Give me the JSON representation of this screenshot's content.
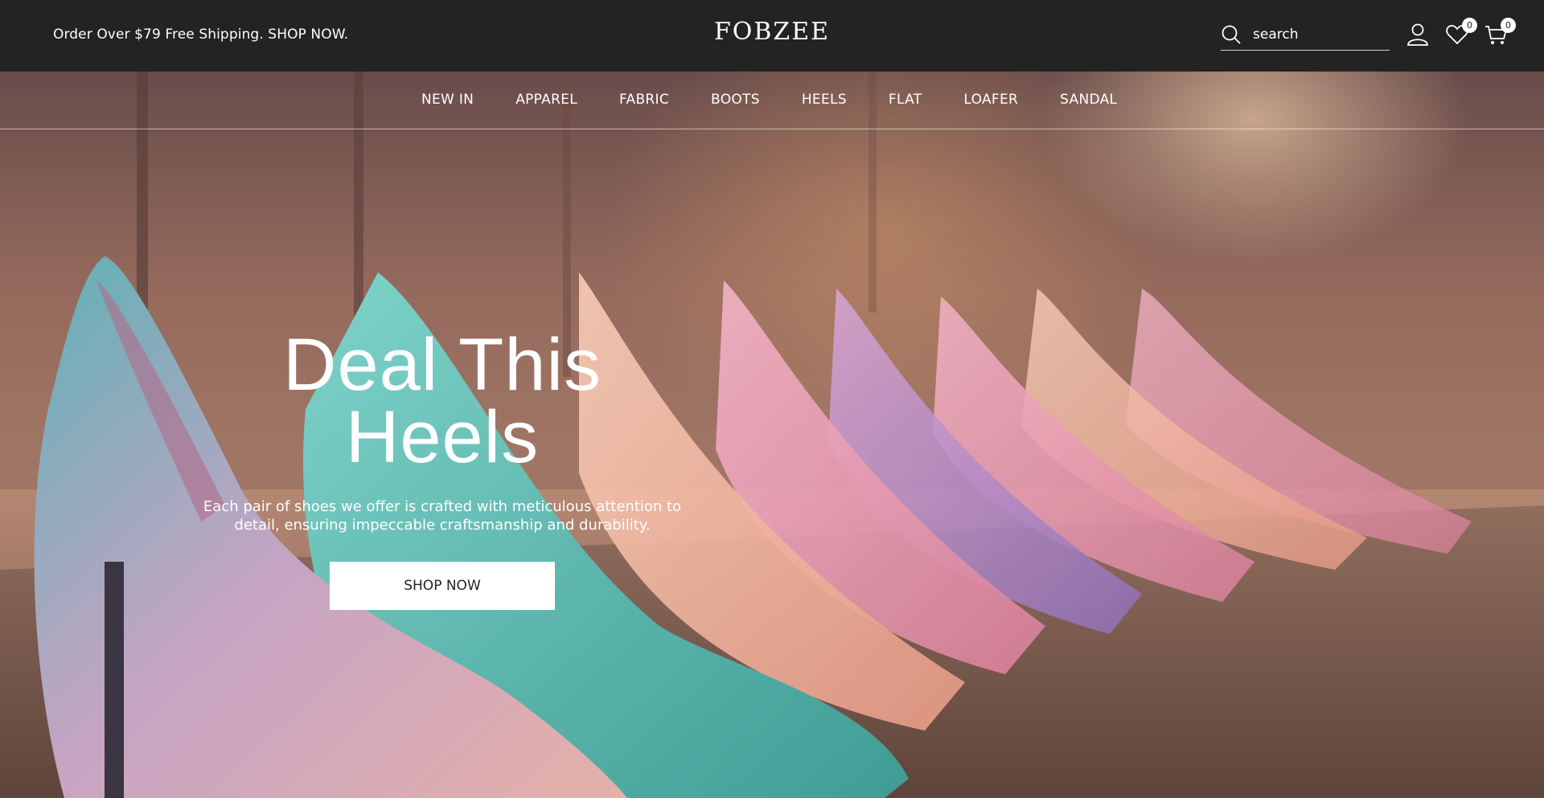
{
  "topbar": {
    "promo": "Order Over $79 Free Shipping. SHOP NOW.",
    "logo": "FOBZEE",
    "search_placeholder": "search",
    "wishlist_count": "0",
    "cart_count": "0"
  },
  "nav": {
    "items": [
      "NEW IN",
      "APPAREL",
      "FABRIC",
      "BOOTS",
      "HEELS",
      "FLAT",
      "LOAFER",
      "SANDAL"
    ]
  },
  "hero": {
    "title_line1": "Deal This",
    "title_line2": "Heels",
    "subtitle": "Each pair of shoes we offer is crafted with meticulous attention to detail, ensuring impeccable craftsmanship and durability.",
    "button": "SHOP NOW"
  },
  "colors": {
    "topbar_bg": "#232323",
    "button_bg": "#ffffff",
    "text": "#ffffff"
  },
  "icons": [
    "search-icon",
    "user-icon",
    "heart-icon",
    "cart-icon"
  ]
}
